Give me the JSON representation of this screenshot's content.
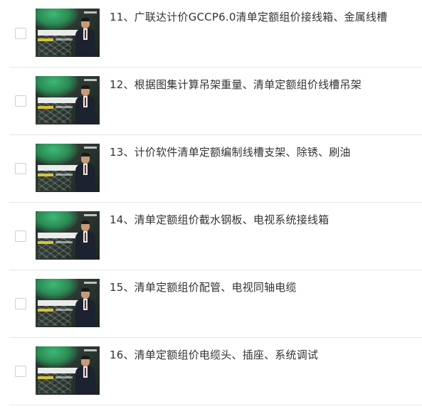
{
  "lessons": [
    {
      "title": "11、广联达计价GCCP6.0清单定额组价接线箱、金属线槽"
    },
    {
      "title": "12、根据图集计算吊架重量、清单定额组价线槽吊架"
    },
    {
      "title": "13、计价软件清单定额编制线槽支架、除锈、刷油"
    },
    {
      "title": "14、清单定额组价截水钢板、电视系统接线箱"
    },
    {
      "title": "15、清单定额组价配管、电视同轴电缆"
    },
    {
      "title": "16、清单定额组价电缆头、插座、系统调试"
    }
  ]
}
